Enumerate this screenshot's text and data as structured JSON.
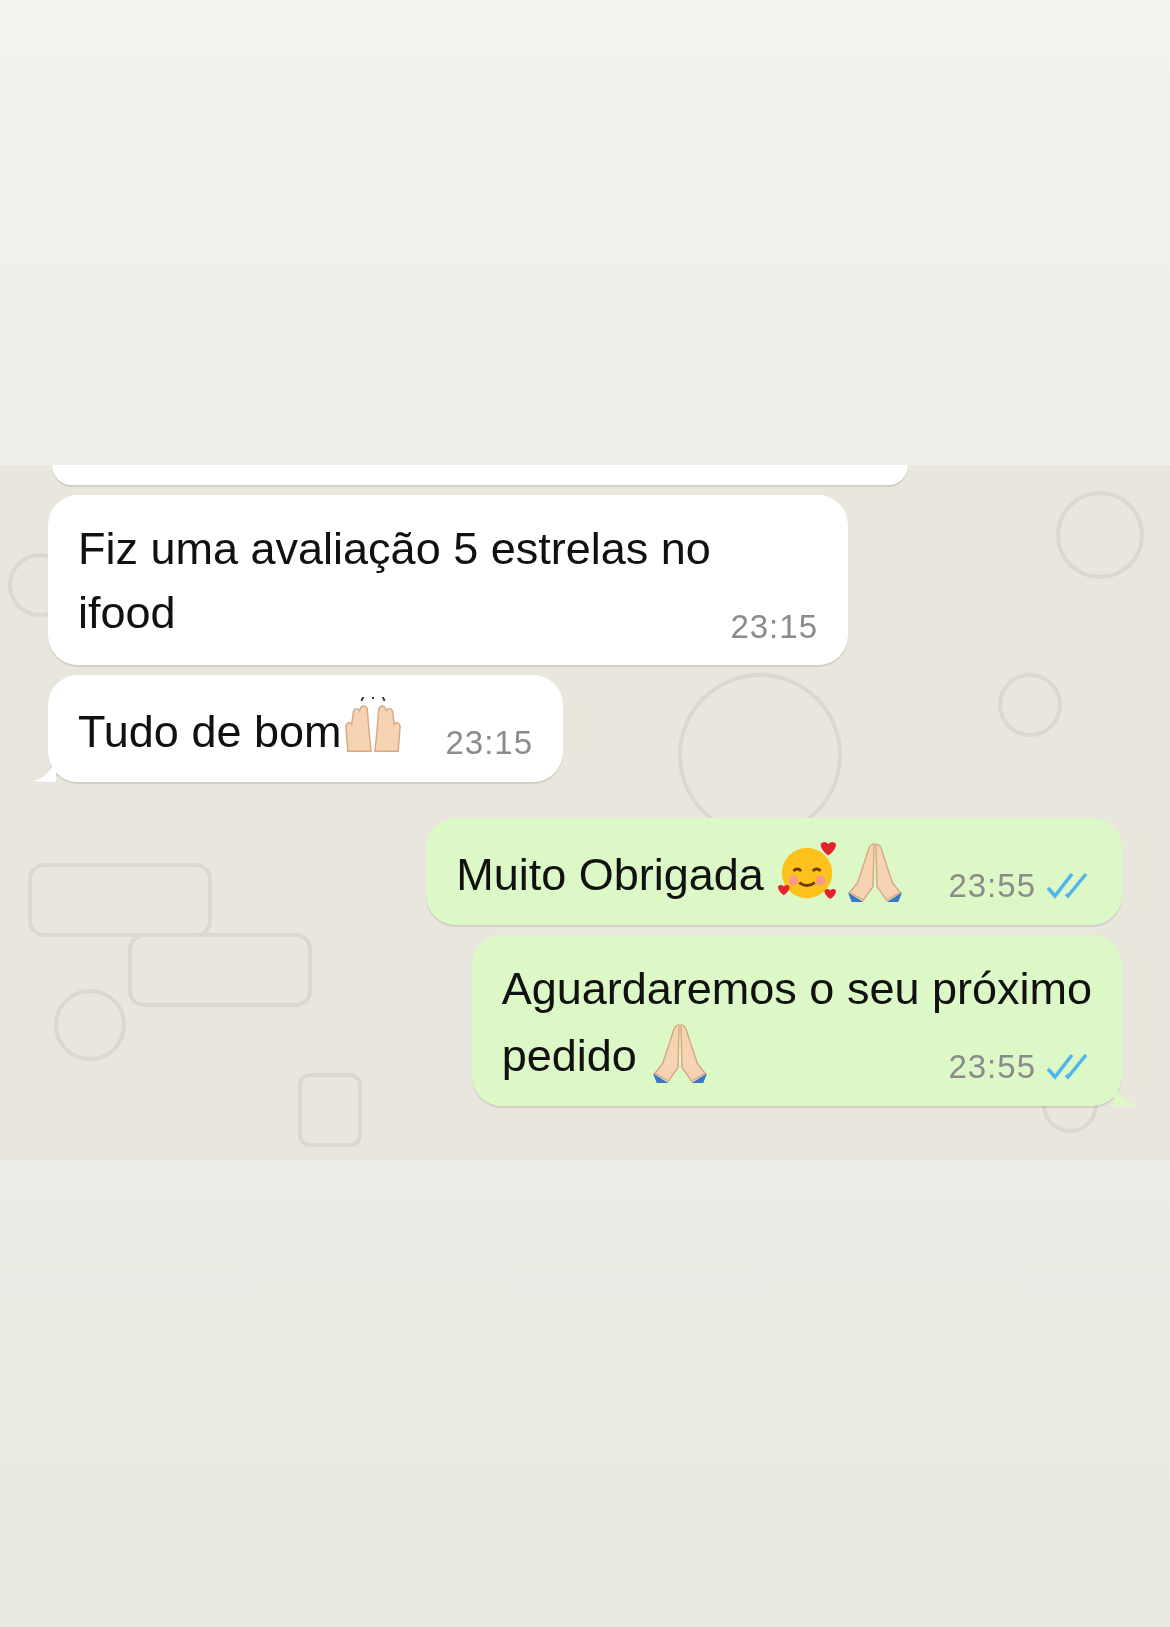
{
  "messages": [
    {
      "kind": "incoming",
      "cut": true
    },
    {
      "kind": "incoming",
      "text": "Fiz uma avaliação 5 estrelas no ifood",
      "time": "23:15",
      "tail": false
    },
    {
      "kind": "incoming",
      "text": "Tudo de bom",
      "emojis": [
        {
          "kind": "raised_hands"
        }
      ],
      "time": "23:15",
      "tail": true
    },
    {
      "kind": "outgoing",
      "text": "Muito Obrigada ",
      "emojis": [
        {
          "kind": "smiling_hearts"
        },
        {
          "kind": "praying_hands"
        }
      ],
      "time": "23:55",
      "read": true,
      "tail": false
    },
    {
      "kind": "outgoing",
      "lines": [
        "Aguardaremos o seu próximo",
        "pedido "
      ],
      "emojis": [
        {
          "kind": "praying_hands"
        }
      ],
      "time": "23:55",
      "read": true,
      "tail": true
    }
  ]
}
